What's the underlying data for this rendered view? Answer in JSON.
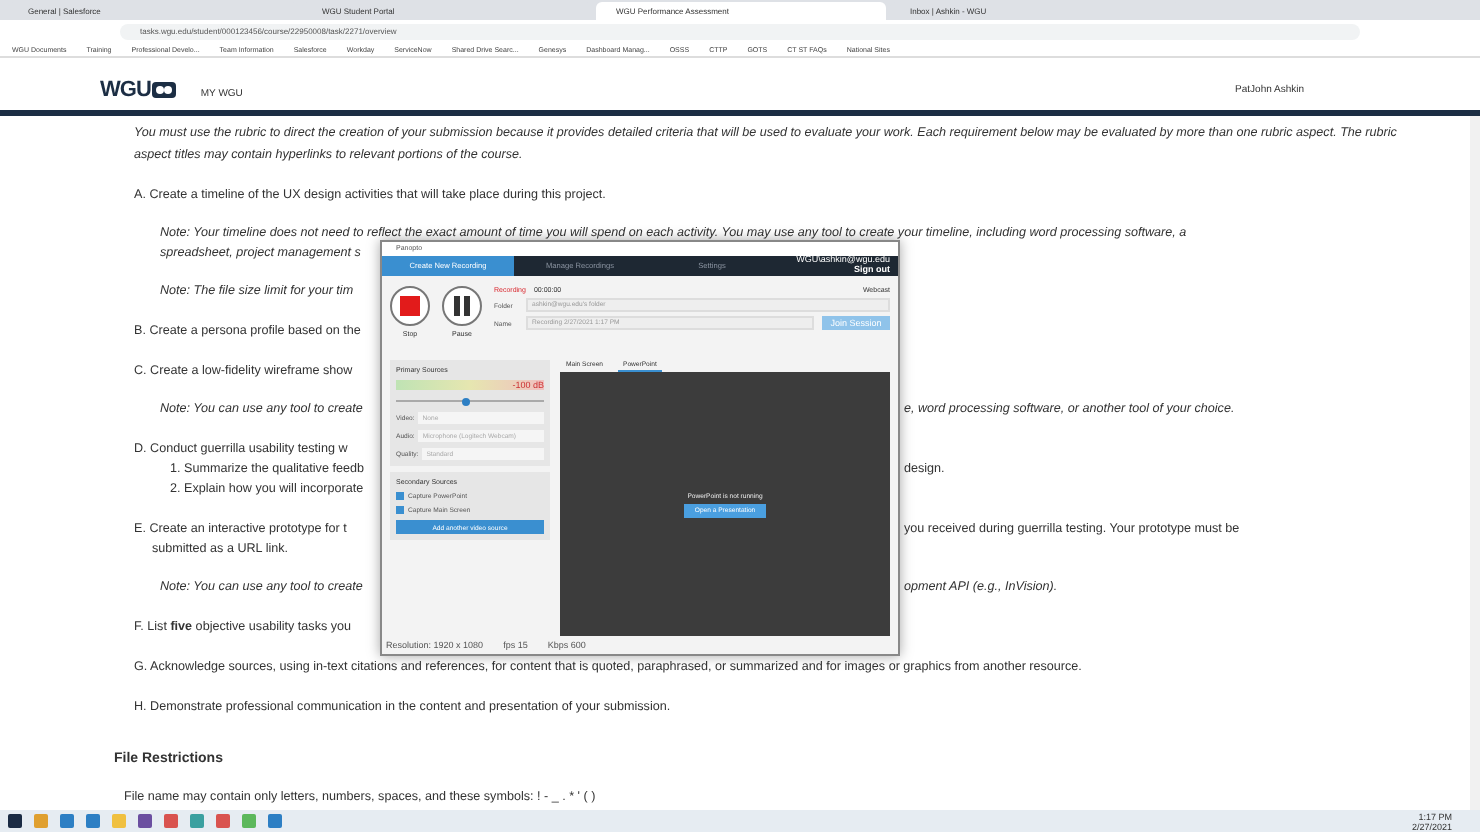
{
  "browser": {
    "tabs": [
      {
        "title": "General | Salesforce",
        "selected": false
      },
      {
        "title": "WGU Student Portal",
        "selected": false
      },
      {
        "title": "WGU Performance Assessment",
        "selected": true
      },
      {
        "title": "Inbox | Ashkin - WGU",
        "selected": false
      }
    ],
    "address": "tasks.wgu.edu/student/000123456/course/22950008/task/2271/overview",
    "bookmarks": [
      "WGU Documents",
      "Training",
      "Professional Develo...",
      "Team Information",
      "Salesforce",
      "Workday",
      "ServiceNow",
      "Shared Drive Searc...",
      "Genesys",
      "Dashboard Manag...",
      "OSSS",
      "CTTP",
      "GOTS",
      "CT ST FAQs",
      "National Sites"
    ]
  },
  "header": {
    "logo": "WGU",
    "nav": "MY WGU",
    "user": "PatJohn Ashkin"
  },
  "document": {
    "intro": "You must use the rubric to direct the creation of your submission because it provides detailed criteria that will be used to evaluate your work. Each requirement below may be evaluated by more than one rubric aspect. The rubric aspect titles may contain hyperlinks to relevant portions of the course.",
    "lines": [
      {
        "kind": "item",
        "marker": "A.",
        "left": "Create a timeline of the UX design activities that will take place during this project."
      },
      {
        "kind": "note",
        "left": "Note: Your timeline does not need to reflect the exact amount of time you will spend on each activity. You may use any tool to create your timeline, including word processing software, a"
      },
      {
        "kind": "cont-note",
        "left": "spreadsheet, project management s"
      },
      {
        "kind": "note",
        "left": "Note: The file size limit for your tim"
      },
      {
        "kind": "item",
        "marker": "B.",
        "left": "Create a persona profile based on the"
      },
      {
        "kind": "item",
        "marker": "C.",
        "left": "Create a low-fidelity wireframe show"
      },
      {
        "kind": "note",
        "left": "Note: You can use any tool to create",
        "right": "e, word processing software, or another tool of your choice."
      },
      {
        "kind": "item",
        "marker": "D.",
        "left": "Conduct guerrilla usability testing w"
      },
      {
        "kind": "sub",
        "marker": "1.",
        "left": "Summarize the qualitative feedb",
        "right": "design."
      },
      {
        "kind": "sub",
        "marker": "2.",
        "left": "Explain how you will incorporate"
      },
      {
        "kind": "item",
        "marker": "E.",
        "left": "Create an interactive prototype for t",
        "right": "you received during guerrilla testing. Your prototype must be"
      },
      {
        "kind": "cont",
        "left": "submitted as a URL link."
      },
      {
        "kind": "note",
        "left": "Note: You can use any tool to create",
        "right": "opment API (e.g., InVision)."
      },
      {
        "kind": "item",
        "marker": "F.",
        "left": "List **five** objective usability tasks you"
      },
      {
        "kind": "item",
        "marker": "G.",
        "left": "Acknowledge sources, using in-text citations and references, for content that is quoted, paraphrased, or summarized and for images or graphics from another resource."
      },
      {
        "kind": "item",
        "marker": "H.",
        "left": "Demonstrate professional communication in the content and presentation of your submission."
      }
    ],
    "section_title": "File Restrictions",
    "section_text": "File name may contain only letters, numbers, spaces, and these symbols: ! - _ . * ' ( )"
  },
  "recorder": {
    "title": "Panopto",
    "tabs": [
      {
        "label": "Create New Recording",
        "selected": true
      },
      {
        "label": "Manage Recordings",
        "selected": false
      },
      {
        "label": "Settings",
        "selected": false
      }
    ],
    "account": "WGU\\ashkin@wgu.edu",
    "sign_out": "Sign out",
    "stop": "Stop",
    "pause": "Pause",
    "status": "Recording",
    "time": "00:00:00",
    "webcast": "Webcast",
    "folder_label": "Folder",
    "folder": "ashkin@wgu.edu's folder",
    "name_label": "Name",
    "name": "Recording 2/27/2021 1:17 PM",
    "join": "Join Session",
    "primary": "Primary Sources",
    "meter_reading": "-100 dB",
    "mic": {
      "level": 0.45
    },
    "sources": [
      {
        "label": "Video:",
        "value": "None"
      },
      {
        "label": "Audio:",
        "value": "Microphone (Logitech Webcam)"
      },
      {
        "label": "Quality:",
        "value": "Standard"
      }
    ],
    "secondary": "Secondary Sources",
    "captures": [
      {
        "label": "Capture PowerPoint",
        "checked": true
      },
      {
        "label": "Capture Main Screen",
        "checked": true
      }
    ],
    "add_source": "Add another video source",
    "preview_tabs": [
      {
        "label": "Main Screen",
        "selected": false
      },
      {
        "label": "PowerPoint",
        "selected": true
      }
    ],
    "preview_message": "PowerPoint is not running",
    "open_button": "Open a Presentation",
    "footer": [
      {
        "label": "Resolution:",
        "value": "1920 x 1080"
      },
      {
        "label": "fps",
        "value": "15"
      },
      {
        "label": "Kbps",
        "value": "600"
      }
    ]
  },
  "taskbar": {
    "time": "1:17 PM",
    "date": "2/27/2021"
  }
}
